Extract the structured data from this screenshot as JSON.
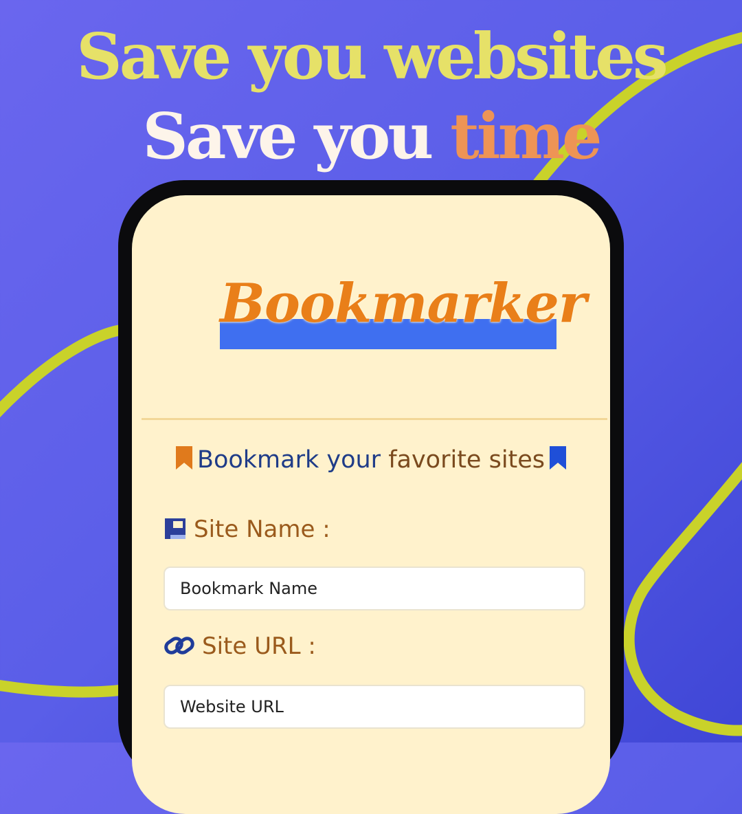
{
  "headline": {
    "line1": "Save you websites",
    "line2_prefix": "Save you ",
    "line2_accent": "time"
  },
  "app": {
    "logo_text": "Bookmarker",
    "subtitle_part1": "Bookmark",
    "subtitle_part2": " your ",
    "subtitle_part3": "favorite sites"
  },
  "form": {
    "site_name_label": "Site Name :",
    "site_name_placeholder": "Bookmark Name",
    "site_url_label": "Site URL :",
    "site_url_placeholder": "Website URL"
  },
  "icons": {
    "bookmark_left": "bookmark-icon",
    "bookmark_right": "bookmark-icon",
    "site_name": "book-icon",
    "site_url": "link-icon"
  },
  "colors": {
    "background": "#5a5ee8",
    "headline_yellow": "#e6e168",
    "headline_white": "#fdf4ea",
    "accent_orange": "#ee9455",
    "screen_cream": "#fff2cc",
    "logo_orange": "#e97f19",
    "logo_bar_blue": "#3f6ff0",
    "swoosh_lime": "#c9d22a"
  }
}
